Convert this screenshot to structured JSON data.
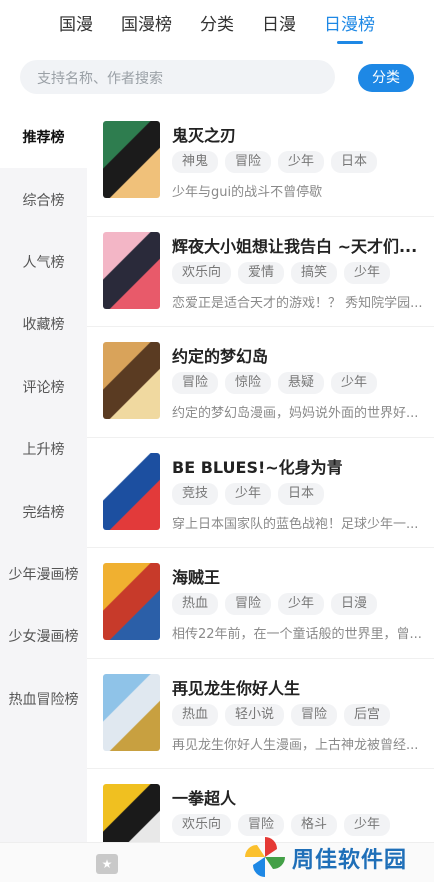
{
  "top_tabs": [
    {
      "label": "国漫",
      "active": false
    },
    {
      "label": "国漫榜",
      "active": false
    },
    {
      "label": "分类",
      "active": false
    },
    {
      "label": "日漫",
      "active": false
    },
    {
      "label": "日漫榜",
      "active": true
    }
  ],
  "search": {
    "placeholder": "支持名称、作者搜索",
    "filter_label": "分类"
  },
  "sidebar": [
    {
      "label": "推荐榜",
      "active": true
    },
    {
      "label": "综合榜",
      "active": false
    },
    {
      "label": "人气榜",
      "active": false
    },
    {
      "label": "收藏榜",
      "active": false
    },
    {
      "label": "评论榜",
      "active": false
    },
    {
      "label": "上升榜",
      "active": false
    },
    {
      "label": "完结榜",
      "active": false
    },
    {
      "label": "少年漫画榜",
      "active": false
    },
    {
      "label": "少女漫画榜",
      "active": false
    },
    {
      "label": "热血冒险榜",
      "active": false
    }
  ],
  "comics": [
    {
      "title": "鬼灭之刃",
      "tags": [
        "神鬼",
        "冒险",
        "少年",
        "日本"
      ],
      "desc": "少年与gui的战斗不曾停歇",
      "cover": [
        "#2e7d4f",
        "#1b1b1b",
        "#f0c17a"
      ]
    },
    {
      "title": "辉夜大小姐想让我告白 ~天才们...",
      "tags": [
        "欢乐向",
        "爱情",
        "搞笑",
        "少年"
      ],
      "desc": "恋爱正是适合天才的游戏！？ 秀知院学园...",
      "cover": [
        "#f3b6c6",
        "#2a2a3a",
        "#e85a6a"
      ]
    },
    {
      "title": "约定的梦幻岛",
      "tags": [
        "冒险",
        "惊险",
        "悬疑",
        "少年"
      ],
      "desc": "约定的梦幻岛漫画，妈妈说外面的世界好...",
      "cover": [
        "#d9a35a",
        "#5a3b22",
        "#f0d9a0"
      ]
    },
    {
      "title": "BE BLUES!~化身为青",
      "tags": [
        "竞技",
        "少年",
        "日本"
      ],
      "desc": "穿上日本国家队的蓝色战袍！足球少年一...",
      "cover": [
        "#ffffff",
        "#1c4fa0",
        "#e23a3a"
      ]
    },
    {
      "title": "海贼王",
      "tags": [
        "热血",
        "冒险",
        "少年",
        "日漫"
      ],
      "desc": "相传22年前，在一个童话般的世界里，曾...",
      "cover": [
        "#f0b030",
        "#c73a2a",
        "#2b5fa8"
      ]
    },
    {
      "title": "再见龙生你好人生",
      "tags": [
        "热血",
        "轻小说",
        "冒险",
        "后宫"
      ],
      "desc": "再见龙生你好人生漫画，上古神龙被曾经...",
      "cover": [
        "#8fc3e8",
        "#e0e8f0",
        "#c8a040"
      ]
    },
    {
      "title": "一拳超人",
      "tags": [
        "欢乐向",
        "冒险",
        "格斗",
        "少年"
      ],
      "desc": "",
      "cover": [
        "#f0c020",
        "#1a1a1a",
        "#e8e8e8"
      ]
    }
  ],
  "bottom_bar": {
    "icon": "star-tab-icon"
  },
  "watermark": {
    "text": "周佳软件园"
  }
}
